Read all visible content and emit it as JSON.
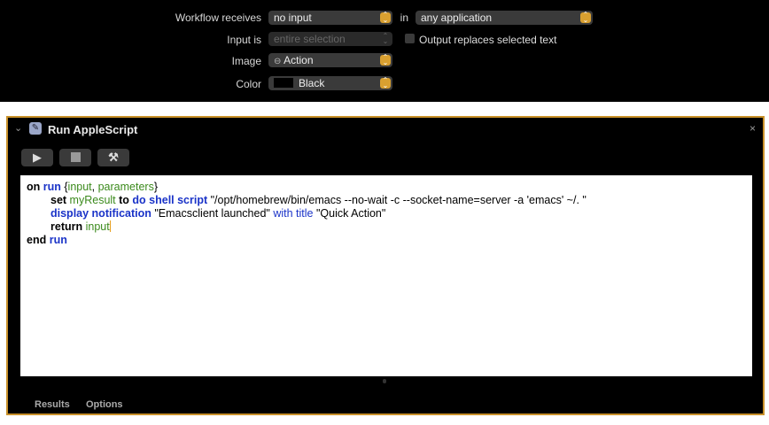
{
  "workflow": {
    "receives_label": "Workflow receives",
    "receives_value": "no input",
    "in_label": "in",
    "application_value": "any application",
    "input_is_label": "Input is",
    "input_is_value": "entire selection",
    "output_replaces_label": "Output replaces selected text",
    "output_replaces_checked": false,
    "image_label": "Image",
    "image_value": "Action",
    "color_label": "Color",
    "color_value": "Black",
    "color_swatch": "#000000"
  },
  "action": {
    "title": "Run AppleScript",
    "accent": "#c9912a",
    "buttons": [
      "play-icon",
      "stop-icon",
      "hammer-icon"
    ],
    "code_lines": [
      {
        "indent": 0,
        "tokens": [
          [
            "kw",
            "on "
          ],
          [
            "cmd",
            "run "
          ],
          [
            "t",
            "{"
          ],
          [
            "var",
            "input"
          ],
          [
            "t",
            ", "
          ],
          [
            "var",
            "parameters"
          ],
          [
            "t",
            "}"
          ]
        ]
      },
      {
        "indent": 1,
        "tokens": [
          [
            "kw",
            "set "
          ],
          [
            "var",
            "myResult "
          ],
          [
            "kw",
            "to "
          ],
          [
            "cmd",
            "do shell script "
          ],
          [
            "t",
            "\"/opt/homebrew/bin/emacs --no-wait -c --socket-name=server -a 'emacs' ~/. \""
          ]
        ]
      },
      {
        "indent": 1,
        "tokens": [
          [
            "cmd",
            "display notification "
          ],
          [
            "t",
            "\"Emacsclient launched\" "
          ],
          [
            "cmdn",
            "with title "
          ],
          [
            "t",
            "\"Quick Action\""
          ]
        ]
      },
      {
        "indent": 1,
        "tokens": [
          [
            "kw",
            "return "
          ],
          [
            "var",
            "input"
          ]
        ],
        "caret": true
      },
      {
        "indent": 0,
        "tokens": [
          [
            "kw",
            "end "
          ],
          [
            "cmd",
            "run"
          ]
        ]
      }
    ],
    "tabs": [
      "Results",
      "Options"
    ]
  }
}
